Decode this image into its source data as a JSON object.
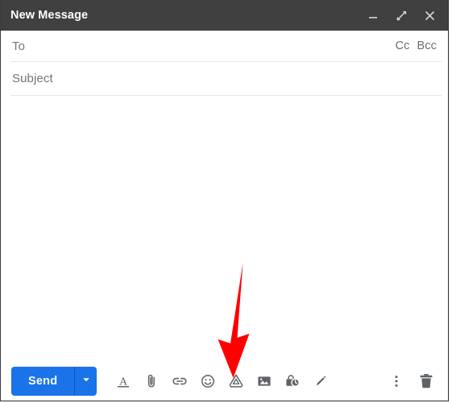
{
  "window": {
    "title": "New Message",
    "controls": [
      {
        "name": "minimize",
        "label": "Minimize",
        "icon": "minimize-icon"
      },
      {
        "name": "expand",
        "label": "Full screen",
        "icon": "expand-icon"
      },
      {
        "name": "close",
        "label": "Save & close",
        "icon": "close-icon"
      }
    ]
  },
  "fields": {
    "to": {
      "label": "To",
      "value": "",
      "placeholder": "To"
    },
    "cc": {
      "label": "Cc"
    },
    "bcc": {
      "label": "Bcc"
    },
    "subject": {
      "label": "Subject",
      "value": "",
      "placeholder": "Subject"
    },
    "body": {
      "value": "",
      "placeholder": ""
    }
  },
  "toolbar": {
    "send_label": "Send",
    "send_options_icon": "chevron-down-icon",
    "icons": [
      {
        "name": "formatting-options-icon",
        "label": "Formatting options"
      },
      {
        "name": "attach-file-icon",
        "label": "Attach files"
      },
      {
        "name": "insert-link-icon",
        "label": "Insert link"
      },
      {
        "name": "insert-emoji-icon",
        "label": "Insert emoji"
      },
      {
        "name": "insert-drive-file-icon",
        "label": "Insert files using Drive"
      },
      {
        "name": "insert-photo-icon",
        "label": "Insert photo"
      },
      {
        "name": "confidential-mode-icon",
        "label": "Toggle confidential mode"
      },
      {
        "name": "insert-signature-icon",
        "label": "Insert signature"
      }
    ],
    "right_icons": [
      {
        "name": "more-options-icon",
        "label": "More options"
      },
      {
        "name": "discard-draft-icon",
        "label": "Discard draft"
      }
    ]
  },
  "annotation": {
    "arrow_color": "#FF0000",
    "points_to": "insert-drive-file-icon"
  },
  "colors": {
    "titlebar_bg": "#404040",
    "send_blue": "#1a73e8",
    "icon_gray": "#5f6368",
    "label_gray": "#757575",
    "divider": "#e8e8e8",
    "annotation_red": "#FF0000"
  }
}
